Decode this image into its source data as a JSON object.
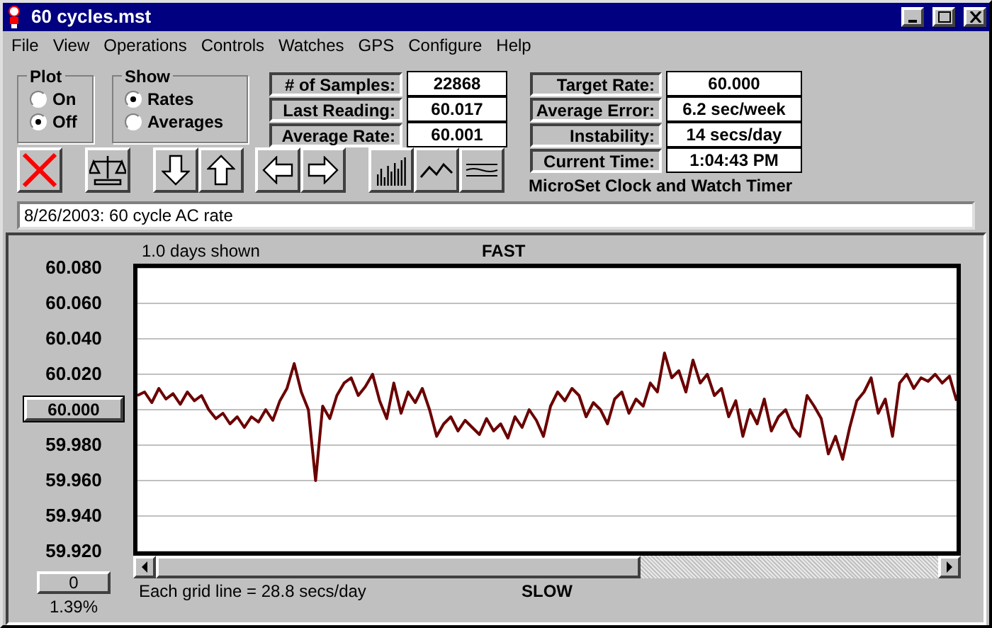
{
  "window": {
    "title": "60 cycles.mst"
  },
  "menu": [
    "File",
    "View",
    "Operations",
    "Controls",
    "Watches",
    "GPS",
    "Configure",
    "Help"
  ],
  "plot_group": {
    "title": "Plot",
    "options": [
      {
        "label": "On",
        "selected": false
      },
      {
        "label": "Off",
        "selected": true
      }
    ]
  },
  "show_group": {
    "title": "Show",
    "options": [
      {
        "label": "Rates",
        "selected": true
      },
      {
        "label": "Averages",
        "selected": false
      }
    ]
  },
  "stats_left": [
    {
      "label": "# of Samples:",
      "value": "22868"
    },
    {
      "label": "Last Reading:",
      "value": "60.017"
    },
    {
      "label": "Average Rate:",
      "value": "60.001"
    }
  ],
  "stats_right": [
    {
      "label": "Target Rate:",
      "value": "60.000"
    },
    {
      "label": "Average Error:",
      "value": "6.2 sec/week"
    },
    {
      "label": "Instability:",
      "value": "14 secs/day"
    },
    {
      "label": "Current Time:",
      "value": "1:04:43 PM"
    }
  ],
  "app_name": "MicroSet Clock and Watch Timer",
  "description": {
    "value": "8/26/2003: 60 cycle AC rate"
  },
  "graph": {
    "days_shown": "1.0 days shown",
    "top_label": "FAST",
    "bottom_label": "SLOW",
    "grid_note": "Each grid line = 28.8 secs/day",
    "offset_button": "0",
    "percent": "1.39%",
    "scroll": {
      "level": 0.62
    },
    "chart_data": {
      "type": "line",
      "grid": true,
      "ylim": [
        59.92,
        60.08
      ],
      "yticks": [
        {
          "value": 60.08,
          "label": "60.080"
        },
        {
          "value": 60.06,
          "label": "60.060"
        },
        {
          "value": 60.04,
          "label": "60.040"
        },
        {
          "value": 60.02,
          "label": "60.020"
        },
        {
          "value": 60.0,
          "label": "60.000"
        },
        {
          "value": 59.98,
          "label": "59.980"
        },
        {
          "value": 59.96,
          "label": "59.960"
        },
        {
          "value": 59.94,
          "label": "59.940"
        },
        {
          "value": 59.92,
          "label": "59.920"
        }
      ],
      "series": [
        {
          "color": "#6b0000",
          "values": [
            60.008,
            60.01,
            60.004,
            60.012,
            60.006,
            60.009,
            60.003,
            60.01,
            60.005,
            60.008,
            60.0,
            59.995,
            59.998,
            59.992,
            59.996,
            59.99,
            59.996,
            59.993,
            60.0,
            59.994,
            60.005,
            60.012,
            60.026,
            60.01,
            60.0,
            59.96,
            60.002,
            59.995,
            60.008,
            60.015,
            60.018,
            60.008,
            60.013,
            60.02,
            60.005,
            59.995,
            60.015,
            59.998,
            60.01,
            60.004,
            60.012,
            60.0,
            59.985,
            59.992,
            59.996,
            59.988,
            59.994,
            59.99,
            59.986,
            59.995,
            59.988,
            59.992,
            59.984,
            59.996,
            59.99,
            60.0,
            59.994,
            59.985,
            60.002,
            60.01,
            60.005,
            60.012,
            60.008,
            59.996,
            60.004,
            60.0,
            59.992,
            60.006,
            60.01,
            59.998,
            60.006,
            60.002,
            60.015,
            60.01,
            60.032,
            60.018,
            60.022,
            60.01,
            60.028,
            60.015,
            60.02,
            60.008,
            60.012,
            59.996,
            60.005,
            59.985,
            60.0,
            59.992,
            60.006,
            59.988,
            59.996,
            60.0,
            59.99,
            59.985,
            60.008,
            60.002,
            59.995,
            59.975,
            59.985,
            59.972,
            59.99,
            60.005,
            60.01,
            60.018,
            59.998,
            60.006,
            59.985,
            60.015,
            60.02,
            60.012,
            60.018,
            60.016,
            60.02,
            60.015,
            60.019,
            60.005
          ]
        }
      ]
    }
  }
}
